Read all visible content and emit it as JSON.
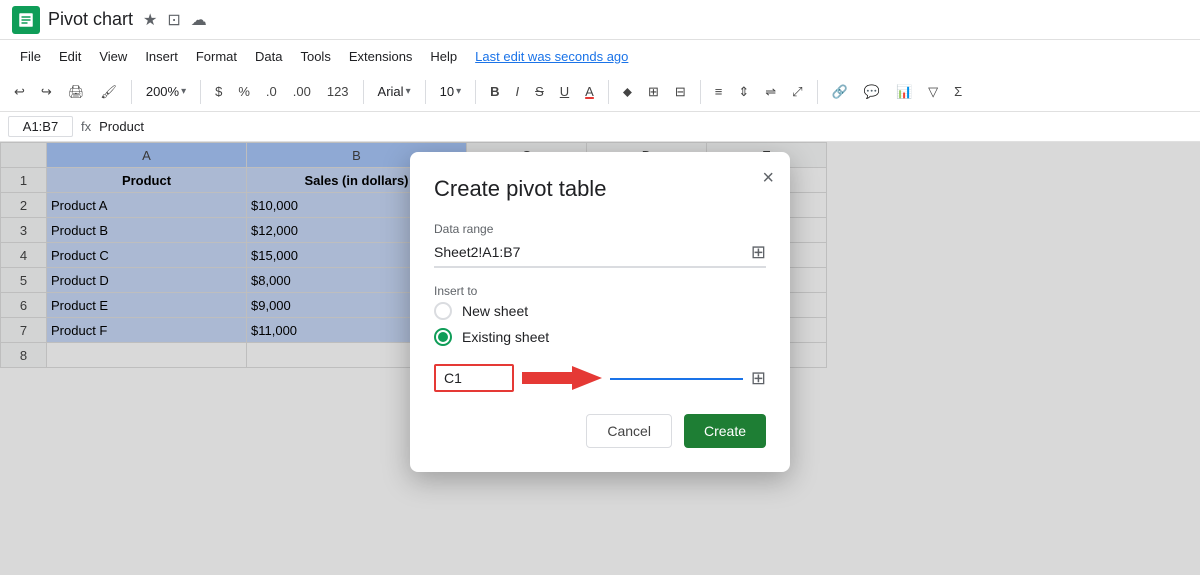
{
  "titleBar": {
    "appIconAlt": "Google Sheets icon",
    "docTitle": "Pivot chart",
    "starIcon": "★",
    "driveIcon": "⊡",
    "cloudIcon": "☁"
  },
  "menuBar": {
    "items": [
      "File",
      "Edit",
      "View",
      "Insert",
      "Format",
      "Data",
      "Tools",
      "Extensions",
      "Help"
    ],
    "lastEdit": "Last edit was seconds ago"
  },
  "toolbar": {
    "undo": "↩",
    "redo": "↪",
    "print": "🖨",
    "paintFormat": "🖌",
    "zoom": "200%",
    "currency": "$",
    "percent": "%",
    "decimal1": ".0",
    "decimal2": ".00",
    "format123": "123",
    "font": "Arial",
    "fontSize": "10",
    "bold": "B",
    "italic": "I",
    "strikethrough": "S",
    "underline": "U",
    "fillColor": "A",
    "borders": "⊞",
    "merge": "⊟",
    "alignH": "≡",
    "alignV": "⇕",
    "textWrap": "⇌",
    "textRotate": "⤢",
    "link": "🔗",
    "comment": "💬",
    "chart": "📊",
    "filter": "▽",
    "sum": "Σ"
  },
  "formulaBar": {
    "cellRef": "A1:B7",
    "fxSymbol": "fx",
    "formula": "Product"
  },
  "sheet": {
    "columns": [
      "",
      "A",
      "B",
      "C",
      "D",
      "E"
    ],
    "rows": [
      {
        "rowNum": "1",
        "a": "Product",
        "b": "Sales (in dollars)",
        "c": "",
        "d": "",
        "e": ""
      },
      {
        "rowNum": "2",
        "a": "Product A",
        "b": "$10,000",
        "c": "",
        "d": "",
        "e": ""
      },
      {
        "rowNum": "3",
        "a": "Product B",
        "b": "$12,000",
        "c": "",
        "d": "",
        "e": ""
      },
      {
        "rowNum": "4",
        "a": "Product C",
        "b": "$15,000",
        "c": "",
        "d": "",
        "e": ""
      },
      {
        "rowNum": "5",
        "a": "Product D",
        "b": "$8,000",
        "c": "",
        "d": "",
        "e": ""
      },
      {
        "rowNum": "6",
        "a": "Product E",
        "b": "$9,000",
        "c": "",
        "d": "",
        "e": ""
      },
      {
        "rowNum": "7",
        "a": "Product F",
        "b": "$11,000",
        "c": "",
        "d": "",
        "e": ""
      },
      {
        "rowNum": "8",
        "a": "",
        "b": "",
        "c": "",
        "d": "",
        "e": ""
      }
    ]
  },
  "dialog": {
    "title": "Create pivot table",
    "closeLabel": "×",
    "dataRangeLabel": "Data range",
    "dataRangeValue": "Sheet2!A1:B7",
    "insertToLabel": "Insert to",
    "newSheetLabel": "New sheet",
    "existingSheetLabel": "Existing sheet",
    "existingSheetSelected": true,
    "locationValue": "C1",
    "locationPlaceholder": "C1",
    "cancelLabel": "Cancel",
    "createLabel": "Create"
  }
}
